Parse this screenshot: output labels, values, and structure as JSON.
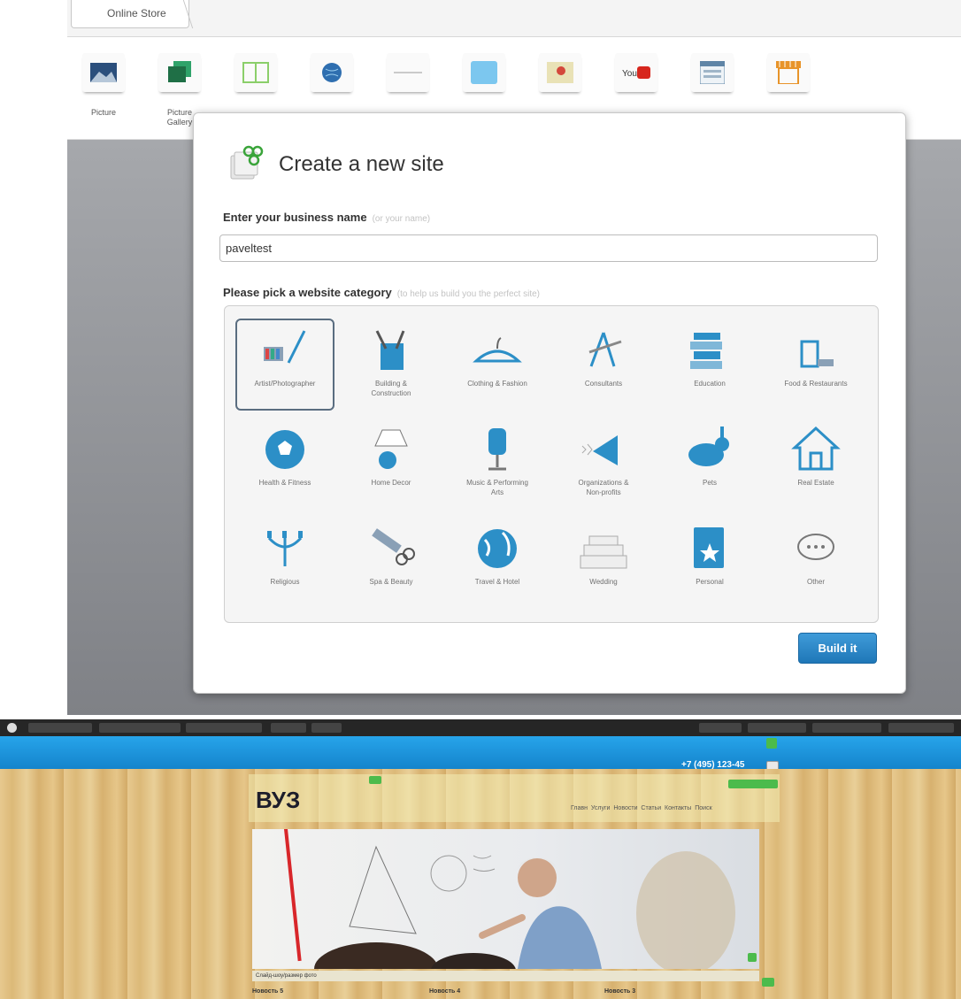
{
  "editor": {
    "tab_label": "Online Store",
    "toolbar_items": [
      {
        "label": "Picture",
        "icon": "picture-icon"
      },
      {
        "label": "Picture\nGallery",
        "icon": "picture-gallery-icon"
      },
      {
        "label": "",
        "icon": "columns-icon"
      },
      {
        "label": "",
        "icon": "globe-icon"
      },
      {
        "label": "",
        "icon": "divider-icon"
      },
      {
        "label": "",
        "icon": "box-icon"
      },
      {
        "label": "",
        "icon": "map-icon"
      },
      {
        "label": "",
        "icon": "youtube-icon"
      },
      {
        "label": "",
        "icon": "form-icon"
      },
      {
        "label": "",
        "icon": "store-icon"
      }
    ]
  },
  "modal": {
    "title": "Create a new site",
    "business_label": "Enter your business name",
    "business_hint": "(or your name)",
    "business_value": "paveltest",
    "category_label": "Please pick a website category",
    "category_hint": "(to help us build you the perfect site)",
    "categories": [
      {
        "label": "Artist/Photographer",
        "icon": "paintbrush-icon",
        "selected": true
      },
      {
        "label": "Building &\nConstruction",
        "icon": "tools-icon",
        "selected": false
      },
      {
        "label": "Clothing & Fashion",
        "icon": "hanger-icon",
        "selected": false
      },
      {
        "label": "Consultants",
        "icon": "compass-icon",
        "selected": false
      },
      {
        "label": "Education",
        "icon": "books-icon",
        "selected": false
      },
      {
        "label": "Food & Restaurants",
        "icon": "food-icon",
        "selected": false
      },
      {
        "label": "Health & Fitness",
        "icon": "soccer-ball-icon",
        "selected": false
      },
      {
        "label": "Home Decor",
        "icon": "lamp-icon",
        "selected": false
      },
      {
        "label": "Music & Performing\nArts",
        "icon": "microphone-icon",
        "selected": false
      },
      {
        "label": "Organizations &\nNon-profits",
        "icon": "megaphone-icon",
        "selected": false
      },
      {
        "label": "Pets",
        "icon": "rabbit-icon",
        "selected": false
      },
      {
        "label": "Real Estate",
        "icon": "house-icon",
        "selected": false
      },
      {
        "label": "Religious",
        "icon": "candelabra-icon",
        "selected": false
      },
      {
        "label": "Spa & Beauty",
        "icon": "comb-scissors-icon",
        "selected": false
      },
      {
        "label": "Travel & Hotel",
        "icon": "globe-icon",
        "selected": false
      },
      {
        "label": "Wedding",
        "icon": "cake-icon",
        "selected": false
      },
      {
        "label": "Personal",
        "icon": "notebook-star-icon",
        "selected": false
      },
      {
        "label": "Other",
        "icon": "speech-bubble-icon",
        "selected": false
      }
    ],
    "build_button": "Build it"
  },
  "preview": {
    "phone": "+7 (495) 123-45",
    "site_title": "ВУЗ",
    "nav": "Главн Услуги Новости Статьи Контакты Поиск",
    "hero_bar_text": "Слайд-шоу/размер фото",
    "news": [
      "Новость 5",
      "Новость 4",
      "Новость 3"
    ]
  },
  "colors": {
    "accent_blue": "#1f77b8",
    "preview_bar": "#1f95df",
    "category_icon": "#2c8fc7"
  }
}
